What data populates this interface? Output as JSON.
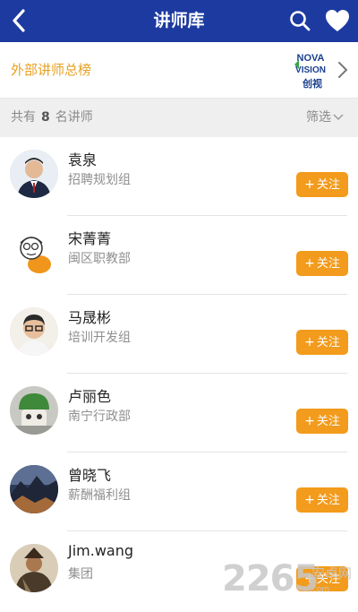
{
  "header": {
    "title": "讲师库",
    "back_icon": "chevron-left-icon",
    "search_icon": "search-icon",
    "favorite_icon": "heart-icon",
    "background": "#1c3aa0"
  },
  "banner": {
    "title": "外部讲师总榜",
    "logo_line1": "NOVA",
    "logo_line2": "VISION",
    "logo_line3": "创视",
    "accent": "#e6a020"
  },
  "filter": {
    "prefix": "共有",
    "count": "8",
    "suffix": "名讲师",
    "filter_label": "筛选"
  },
  "follow_label": "关注",
  "follow_color": "#f29b1c",
  "lecturers": [
    {
      "name": "袁泉",
      "dept": "招聘规划组",
      "avatar": "man-in-suit-avatar"
    },
    {
      "name": "宋菁菁",
      "dept": "闽区职教部",
      "avatar": "cartoon-avatar"
    },
    {
      "name": "马晟彬",
      "dept": "培训开发组",
      "avatar": "man-with-glasses-avatar"
    },
    {
      "name": "卢丽色",
      "dept": "南宁行政部",
      "avatar": "green-helmet-avatar"
    },
    {
      "name": "曾晓飞",
      "dept": "薪酬福利组",
      "avatar": "landscape-avatar"
    },
    {
      "name": "Jim.wang",
      "dept": "集团",
      "avatar": "warrior-avatar"
    }
  ],
  "watermark": {
    "number": "2265",
    "text": "安卓网",
    "url": ".com"
  }
}
